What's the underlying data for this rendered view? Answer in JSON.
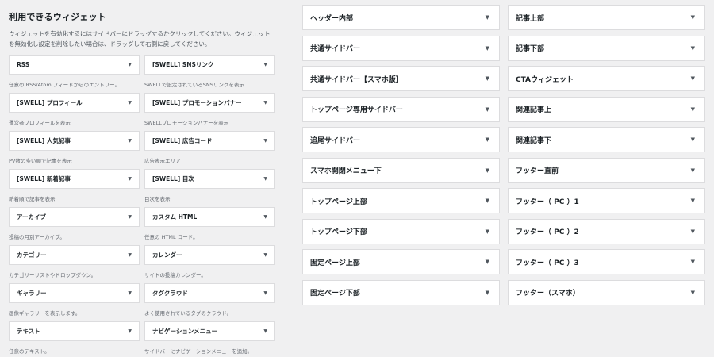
{
  "available": {
    "title": "利用できるウィジェット",
    "description": "ウィジェットを有効化するにはサイドバーにドラッグするかクリックしてください。ウィジェットを無効化し設定を削除したい場合は、ドラッグして右側に戻してください。",
    "widgets": [
      {
        "title": "RSS",
        "desc": "任意の RSS/Atom フィードからのエントリー。"
      },
      {
        "title": "[SWELL] SNSリンク",
        "desc": "SWELLで設定されているSNSリンクを表示"
      },
      {
        "title": "[SWELL] プロフィール",
        "desc": "運営者プロフィールを表示"
      },
      {
        "title": "[SWELL] プロモーションバナー",
        "desc": "SWELLプロモーションバナーを表示"
      },
      {
        "title": "[SWELL] 人気記事",
        "desc": "PV数の多い順で記事を表示"
      },
      {
        "title": "[SWELL] 広告コード",
        "desc": "広告表示エリア"
      },
      {
        "title": "[SWELL] 新着記事",
        "desc": "新着順で記事を表示"
      },
      {
        "title": "[SWELL] 目次",
        "desc": "目次を表示"
      },
      {
        "title": "アーカイブ",
        "desc": "投稿の月別アーカイブ。"
      },
      {
        "title": "カスタム HTML",
        "desc": "任意の HTML コード。"
      },
      {
        "title": "カテゴリー",
        "desc": "カテゴリーリストやドロップダウン。"
      },
      {
        "title": "カレンダー",
        "desc": "サイトの投稿カレンダー。"
      },
      {
        "title": "ギャラリー",
        "desc": "画像ギャラリーを表示します。"
      },
      {
        "title": "タグクラウド",
        "desc": "よく使用されているタグのクラウド。"
      },
      {
        "title": "テキスト",
        "desc": "任意のテキスト。"
      },
      {
        "title": "ナビゲーションメニュー",
        "desc": "サイドバーにナビゲーションメニューを追加。"
      }
    ]
  },
  "areas_left": [
    "ヘッダー内部",
    "共通サイドバー",
    "共通サイドバー【スマホ版】",
    "トップページ専用サイドバー",
    "追尾サイドバー",
    "スマホ開閉メニュー下",
    "トップページ上部",
    "トップページ下部",
    "固定ページ上部",
    "固定ページ下部"
  ],
  "areas_right": [
    "記事上部",
    "記事下部",
    "CTAウィジェット",
    "関連記事上",
    "関連記事下",
    "フッター直前",
    "フッター（ PC ）1",
    "フッター（ PC ）2",
    "フッター（ PC ）3",
    "フッター（スマホ）"
  ],
  "icons": {
    "toggle": "▼"
  }
}
